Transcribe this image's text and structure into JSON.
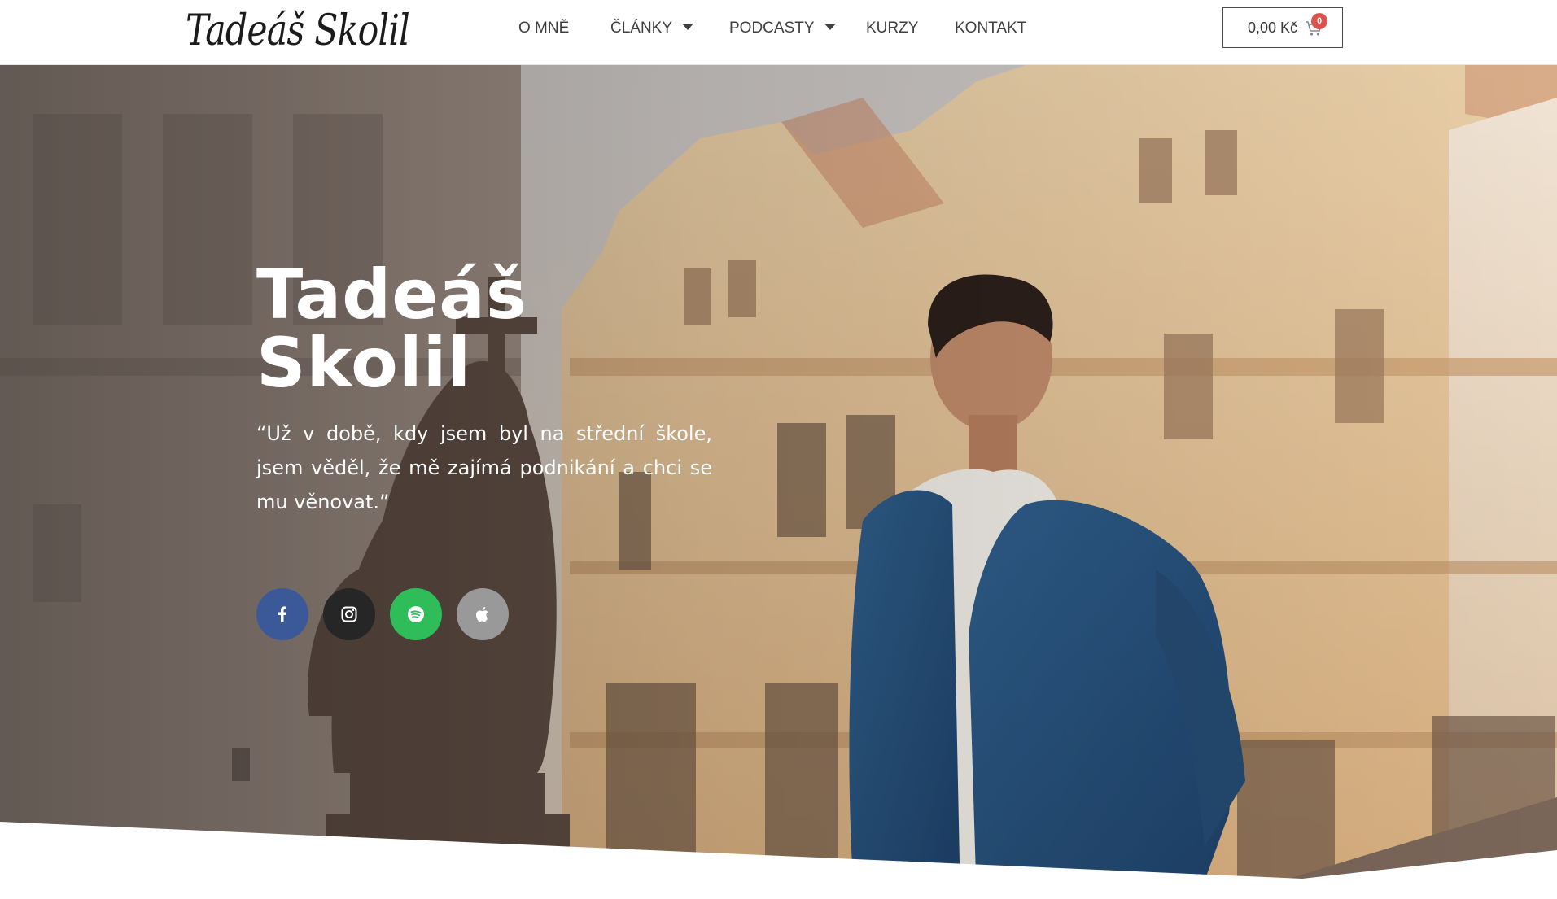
{
  "header": {
    "logo_text": "Tadeáš Skolil",
    "nav": [
      {
        "label": "O mně",
        "has_dropdown": false
      },
      {
        "label": "Články",
        "has_dropdown": true
      },
      {
        "label": "Podcasty",
        "has_dropdown": true
      },
      {
        "label": "Kurzy",
        "has_dropdown": false
      },
      {
        "label": "Kontakt",
        "has_dropdown": false
      }
    ],
    "cart": {
      "total": "0,00 Kč",
      "count": "0",
      "icon": "shopping-cart-icon"
    }
  },
  "hero": {
    "title_line1": "Tadeáš",
    "title_line2": "Skolil",
    "quote": "“Už v době, kdy jsem byl na střední škole, jsem věděl, že mě zajímá podnikání a chci se mu věnovat.”",
    "social": [
      {
        "name": "facebook",
        "icon": "facebook-icon",
        "color": "#3b5998"
      },
      {
        "name": "instagram",
        "icon": "instagram-icon",
        "color": "#262626"
      },
      {
        "name": "spotify",
        "icon": "spotify-icon",
        "color": "#2ebd59"
      },
      {
        "name": "apple-podcasts",
        "icon": "apple-icon",
        "color": "#999999"
      }
    ]
  }
}
